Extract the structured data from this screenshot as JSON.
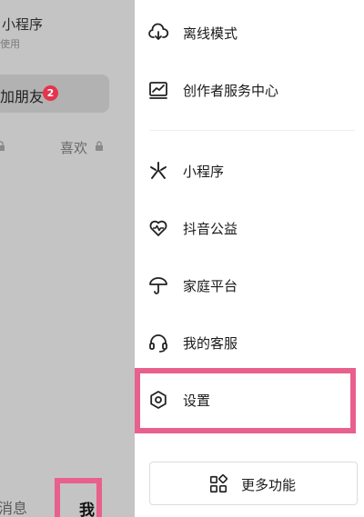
{
  "background": {
    "mini_program_title": "小程序",
    "mini_program_subtitle": "使用",
    "add_friend_label": "加朋友",
    "friend_badge_count": "2",
    "likes_label": "喜欢",
    "nav_messages": "消息",
    "nav_me": "我"
  },
  "drawer": {
    "items": [
      {
        "label": "离线模式",
        "icon": "cloud-download-icon"
      },
      {
        "label": "创作者服务中心",
        "icon": "chart-icon"
      },
      {
        "label": "小程序",
        "icon": "mini-program-icon"
      },
      {
        "label": "抖音公益",
        "icon": "heart-icon"
      },
      {
        "label": "家庭平台",
        "icon": "umbrella-icon"
      },
      {
        "label": "我的客服",
        "icon": "headset-icon"
      },
      {
        "label": "设置",
        "icon": "gear-icon"
      }
    ],
    "more_label": "更多功能"
  },
  "colors": {
    "highlight": "#e8608c",
    "badge": "#e5344d",
    "overlay": "#c4c4c4"
  }
}
